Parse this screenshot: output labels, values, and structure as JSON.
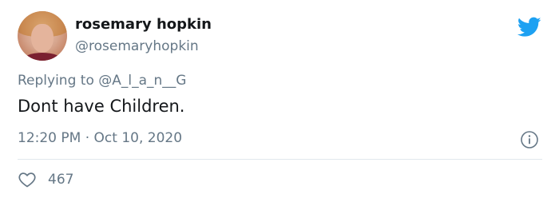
{
  "author": {
    "name": "rosemary hopkin",
    "handle": "@rosemaryhopkin",
    "avatar_icon": "profile-photo"
  },
  "reply": {
    "prefix": "Replying to",
    "mention": "@A_l_a_n__G"
  },
  "tweet": {
    "text": "Dont have Children.",
    "time": "12:20 PM",
    "separator": "·",
    "date": "Oct 10, 2020"
  },
  "engagement": {
    "likes": "467"
  },
  "icons": {
    "brand": "twitter-bird-icon",
    "info": "info-icon",
    "like": "heart-icon"
  },
  "colors": {
    "twitter_blue": "#1da1f2",
    "secondary_text": "#657786",
    "primary_text": "#14171a",
    "divider": "#e1e8ed"
  }
}
